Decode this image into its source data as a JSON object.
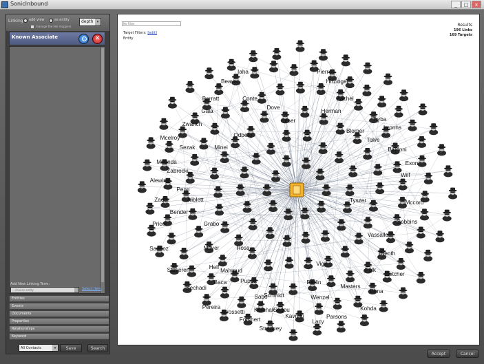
{
  "window": {
    "title": "SonicInbound",
    "minimize": "_",
    "maximize": "□",
    "close": "x"
  },
  "left": {
    "linking_label": "Linking",
    "radio1": "add view",
    "radio2": "as entity",
    "depth": "depth 1",
    "checkbox_text": "manage the link mappers",
    "associate_header": "Known Associate",
    "add_link_label": "Add New Linking Term:",
    "link_placeholder": "...choose entity",
    "link_button": "Select Item",
    "categories": [
      "Entities",
      "Events",
      "Documents",
      "Properties",
      "Relationships",
      "Keyword"
    ],
    "bottom_select": "All Contacts",
    "save": "Save",
    "search": "Search"
  },
  "main": {
    "filter_placeholder": "No Filter",
    "target_filters": "Target Filters:",
    "edit": "[edit]",
    "entity": "Entity",
    "results_title": "Results",
    "links": "196 Links",
    "targets": "169 Targets"
  },
  "graph_labels": [
    "Iaha",
    "Pierre",
    "Beaver",
    "Hirzinger",
    "Barratt",
    "Conte",
    "Dove",
    "Rachel",
    "Gala",
    "Zwarich",
    "Leser",
    "Herman",
    "Tryba",
    "Mcelroy",
    "Odberg",
    "Blomer",
    "Lyonns",
    "Sezak",
    "Minei",
    "Tolve",
    "Baldoni",
    "Miranda",
    "Exon",
    "Alewine",
    "Zabrocki",
    "Wilf",
    "Zador",
    "Penn",
    "Niblett",
    "Tyszer",
    "Mccord",
    "Pricer",
    "Bender",
    "Grabo",
    "Gobbins",
    "Sandoz",
    "Moyer",
    "Rosa",
    "Vassallo",
    "Drenth",
    "Staveren",
    "Helf",
    "Mahmud",
    "Vigil",
    "Polk",
    "Fletcher",
    "Kechadi",
    "Baca",
    "Puppa",
    "Masters",
    "Bena",
    "Pereira",
    "Grossetti",
    "Sabo",
    "Schmidt",
    "Berlin",
    "Wenzel",
    "Kohda",
    "Forchert",
    "Kerchak",
    "Sedou",
    "Kavraki",
    "Lacy",
    "Parsons",
    "Stredney"
  ],
  "bottom": {
    "accept": "Accept",
    "cancel": "Cancel"
  }
}
